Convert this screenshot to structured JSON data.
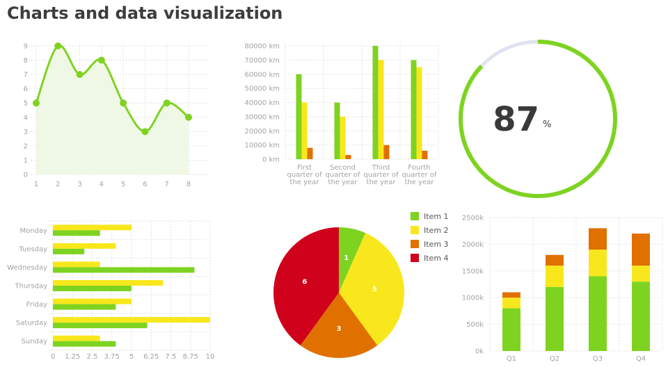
{
  "page": {
    "title": "Charts and data visualization"
  },
  "colors": {
    "green": "#7ed321",
    "yellow": "#f8e71c",
    "orange": "#e07000",
    "red": "#d0021b",
    "gauge_track": "#dfe3ee",
    "line_fill": "#eff8e4"
  },
  "chart_data": [
    {
      "type": "line",
      "x": [
        1,
        2,
        3,
        4,
        5,
        6,
        7,
        8
      ],
      "y": [
        5,
        9,
        7,
        8,
        5,
        3,
        5,
        4
      ],
      "xlim": [
        1,
        8
      ],
      "ylim": [
        0,
        9
      ],
      "x_ticks": [
        "1",
        "2",
        "3",
        "4",
        "5",
        "6",
        "7",
        "8"
      ],
      "y_ticks": [
        "0",
        "1",
        "2",
        "3",
        "4",
        "5",
        "6",
        "7",
        "8",
        "9"
      ],
      "smooth": true,
      "area_fill": true,
      "grid": true
    },
    {
      "type": "bar",
      "orientation": "vertical",
      "categories": [
        [
          "First",
          "quarter of",
          "the year"
        ],
        [
          "Second",
          "quarter of",
          "the year"
        ],
        [
          "Third",
          "quarter of",
          "the year"
        ],
        [
          "Fourth",
          "quarter of",
          "the year"
        ]
      ],
      "series": [
        {
          "values": [
            60000,
            40000,
            80000,
            70000
          ],
          "color": "#7ed321"
        },
        {
          "values": [
            40000,
            30000,
            70000,
            65000
          ],
          "color": "#f8e71c"
        },
        {
          "values": [
            8000,
            3000,
            10000,
            6000
          ],
          "color": "#e07000"
        }
      ],
      "ylim": [
        0,
        80000
      ],
      "y_ticks": [
        "0 km",
        "10000 km",
        "20000 km",
        "30000 km",
        "40000 km",
        "50000 km",
        "60000 km",
        "70000 km",
        "80000 km"
      ],
      "grid": true
    },
    {
      "type": "gauge",
      "value": 87,
      "display": "87",
      "unit": "%"
    },
    {
      "type": "bar",
      "orientation": "horizontal",
      "categories": [
        "Monday",
        "Tuesday",
        "Wednesday",
        "Thursday",
        "Friday",
        "Saturday",
        "Sunday"
      ],
      "series": [
        {
          "values": [
            5,
            4,
            3,
            7,
            5,
            10,
            3
          ],
          "color": "#f8e71c"
        },
        {
          "values": [
            3,
            2,
            9,
            5,
            4,
            6,
            4
          ],
          "color": "#7ed321"
        }
      ],
      "xlim": [
        0,
        10
      ],
      "x_ticks": [
        "0",
        "1.25",
        "2.5",
        "3.75",
        "5",
        "6.25",
        "7.5",
        "8.75",
        "10"
      ],
      "grid": true
    },
    {
      "type": "pie",
      "labels": [
        "Item 1",
        "Item 2",
        "Item 3",
        "Item 4"
      ],
      "values": [
        1,
        5,
        3,
        6
      ],
      "slice_labels": [
        "1",
        "5",
        "3",
        "6"
      ],
      "colors": [
        "#7ed321",
        "#f8e71c",
        "#e07000",
        "#d0021b"
      ],
      "legend": "top-right"
    },
    {
      "type": "bar",
      "orientation": "vertical",
      "stacked": true,
      "categories": [
        "Q1",
        "Q2",
        "Q3",
        "Q4"
      ],
      "series": [
        {
          "values": [
            800,
            1200,
            1400,
            1300
          ],
          "color": "#7ed321"
        },
        {
          "values": [
            200,
            400,
            500,
            300
          ],
          "color": "#f8e71c"
        },
        {
          "values": [
            100,
            200,
            400,
            600
          ],
          "color": "#e07000"
        }
      ],
      "ylim": [
        0,
        2500
      ],
      "y_ticks": [
        "0k",
        "500k",
        "1000k",
        "1500k",
        "2000k",
        "2500k"
      ],
      "grid": true
    }
  ]
}
